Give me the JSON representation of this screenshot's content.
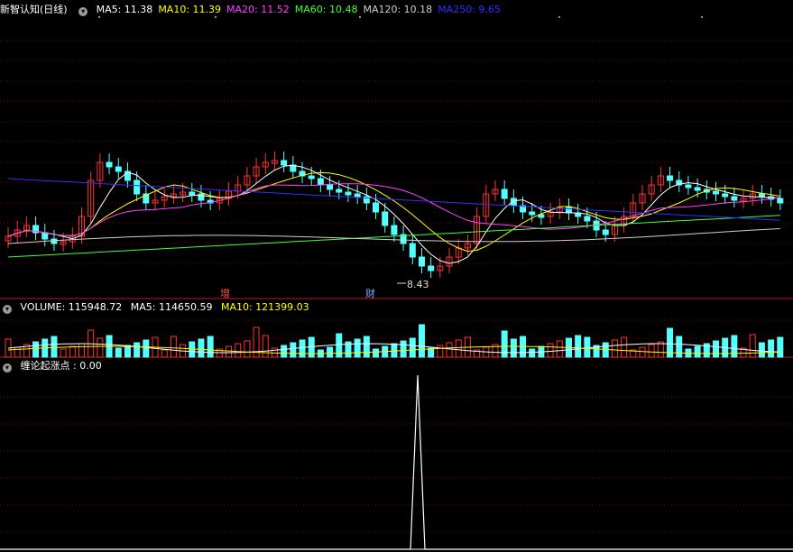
{
  "title": "新智认知(日线)",
  "main_ma": [
    {
      "label": "MA5: 11.38",
      "color": "#ffffff"
    },
    {
      "label": "MA10: 11.39",
      "color": "#ffff00"
    },
    {
      "label": "MA20: 11.52",
      "color": "#ff40ff"
    },
    {
      "label": "MA60: 10.48",
      "color": "#40ff40"
    },
    {
      "label": "MA120: 10.18",
      "color": "#cfcfcf"
    },
    {
      "label": "MA250: 9.65",
      "color": "#3030ff"
    }
  ],
  "low_label": "8.43",
  "markers": {
    "zeng": "增",
    "cai": "财"
  },
  "volume": {
    "label": "VOLUME: 115948.72",
    "ma5": "MA5: 114650.59",
    "ma10": "MA10: 121399.03"
  },
  "indicator": {
    "label": "缠论起涨点 : 0.00"
  },
  "colors": {
    "up": "#ff3232",
    "down": "#54ffff",
    "grid": "#8b0000",
    "divider": "#c01818"
  },
  "icons": {
    "toggle": "chevron-down-icon"
  }
}
